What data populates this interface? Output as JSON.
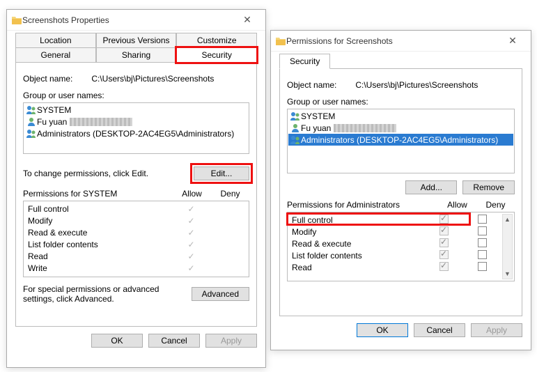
{
  "dialog1": {
    "title": "Screenshots Properties",
    "tabs_row1": [
      "Location",
      "Previous Versions",
      "Customize"
    ],
    "tabs_row2": [
      "General",
      "Sharing",
      "Security"
    ],
    "object_label": "Object name:",
    "object_path": "C:\\Users\\bj\\Pictures\\Screenshots",
    "group_label": "Group or user names:",
    "users": [
      "SYSTEM",
      "Fu yuan",
      "Administrators (DESKTOP-2AC4EG5\\Administrators)"
    ],
    "change_hint": "To change permissions, click Edit.",
    "edit_label": "Edit...",
    "perm_for": "Permissions for SYSTEM",
    "col_allow": "Allow",
    "col_deny": "Deny",
    "perms": [
      "Full control",
      "Modify",
      "Read & execute",
      "List folder contents",
      "Read",
      "Write"
    ],
    "adv_hint": "For special permissions or advanced settings, click Advanced.",
    "advanced_label": "Advanced",
    "ok": "OK",
    "cancel": "Cancel",
    "apply": "Apply"
  },
  "dialog2": {
    "title": "Permissions for Screenshots",
    "tab": "Security",
    "object_label": "Object name:",
    "object_path": "C:\\Users\\bj\\Pictures\\Screenshots",
    "group_label": "Group or user names:",
    "users": [
      "SYSTEM",
      "Fu yuan",
      "Administrators (DESKTOP-2AC4EG5\\Administrators)"
    ],
    "add_label": "Add...",
    "remove_label": "Remove",
    "perm_for": "Permissions for Administrators",
    "col_allow": "Allow",
    "col_deny": "Deny",
    "perms": [
      "Full control",
      "Modify",
      "Read & execute",
      "List folder contents",
      "Read"
    ],
    "ok": "OK",
    "cancel": "Cancel",
    "apply": "Apply"
  }
}
